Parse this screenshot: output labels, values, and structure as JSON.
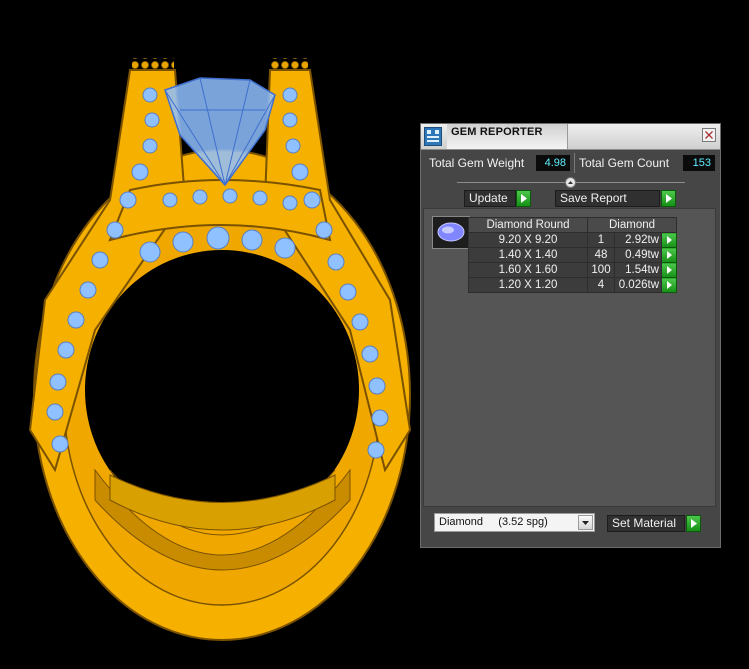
{
  "panel": {
    "title": "GEM REPORTER",
    "total_gem_weight_label": "Total Gem Weight",
    "total_gem_weight_value": "4.98",
    "total_gem_count_label": "Total Gem Count",
    "total_gem_count_value": "153",
    "update_label": "Update",
    "save_report_label": "Save Report",
    "table": {
      "shape_header": "Diamond Round",
      "material_header": "Diamond",
      "rows": [
        {
          "size": "9.20 X 9.20",
          "qty": "1",
          "weight": "2.92tw"
        },
        {
          "size": "1.40 X 1.40",
          "qty": "48",
          "weight": "0.49tw"
        },
        {
          "size": "1.60 X 1.60",
          "qty": "100",
          "weight": "1.54tw"
        },
        {
          "size": "1.20 X 1.20",
          "qty": "4",
          "weight": "0.026tw"
        }
      ]
    },
    "material_select": "Diamond     (3.52 spg)",
    "set_material_label": "Set Material"
  },
  "colors": {
    "ring_gold": "#f5b000",
    "gem_blue": "#8fc0ff",
    "panel_bg": "#464646",
    "value_text": "#5ff0ff",
    "arrow_green": "#2fb82f"
  },
  "icons": [
    "app-icon",
    "close-icon",
    "collapse-icon",
    "play-arrow-icon",
    "gem-thumbnail-icon",
    "dropdown-arrow-icon"
  ]
}
